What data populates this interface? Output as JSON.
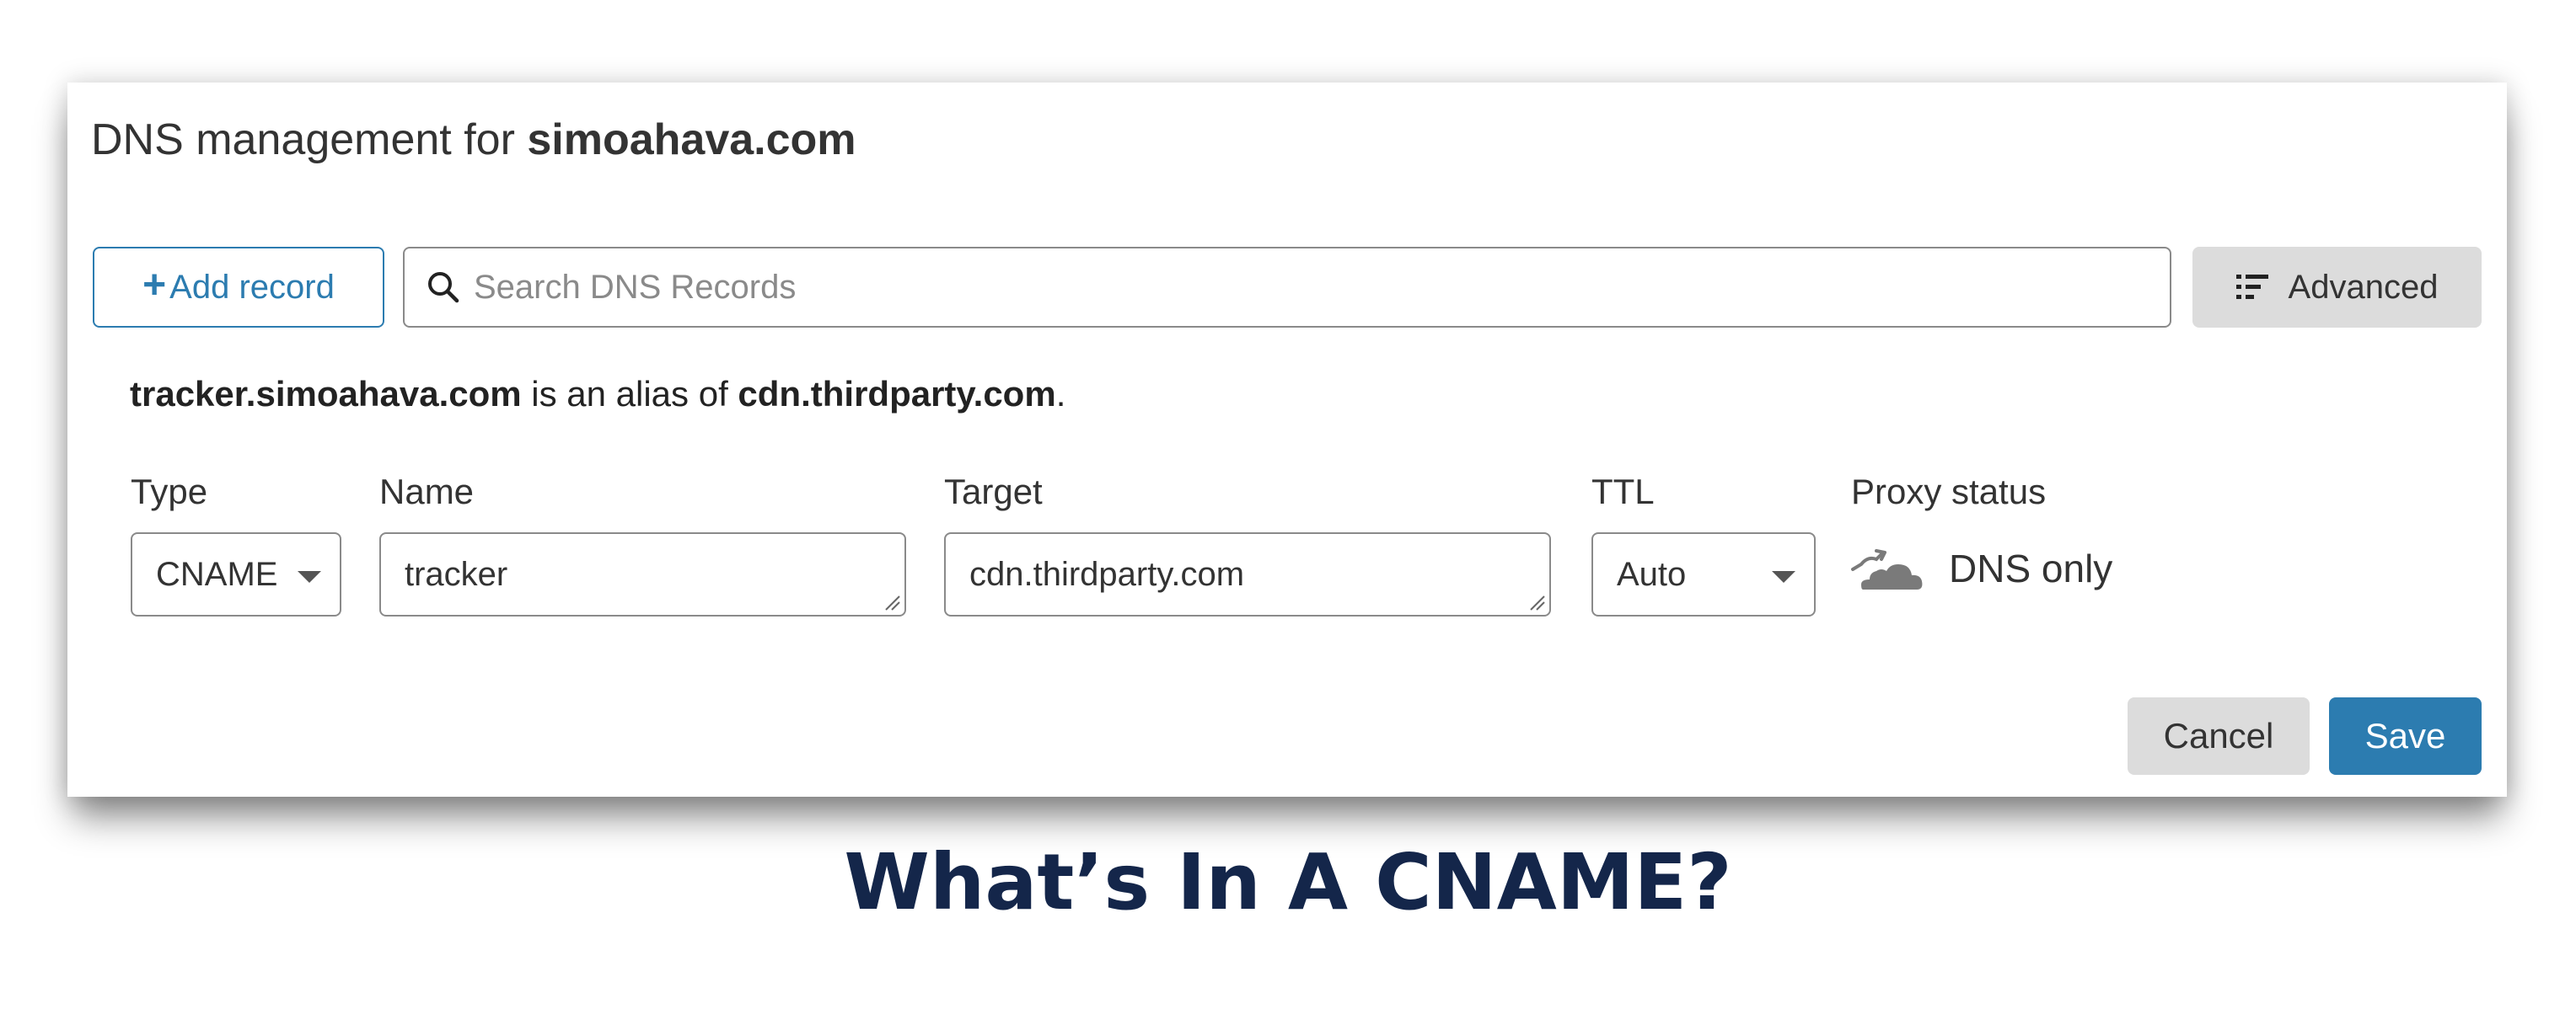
{
  "dialog": {
    "title_prefix": "DNS management for ",
    "title_domain": "simoahava.com"
  },
  "toolbar": {
    "add_record_icon": "+",
    "add_record_label": "Add record",
    "search_placeholder": "Search DNS Records",
    "search_icon": "search-icon",
    "advanced_icon": "list-filter-icon",
    "advanced_label": "Advanced"
  },
  "alias_notice": {
    "host": "tracker.simoahava.com",
    "middle": " is an alias of ",
    "target": "cdn.thirdparty.com",
    "end": "."
  },
  "form": {
    "type_label": "Type",
    "type_value": "CNAME",
    "name_label": "Name",
    "name_value": "tracker",
    "target_label": "Target",
    "target_value": "cdn.thirdparty.com",
    "ttl_label": "TTL",
    "ttl_value": "Auto",
    "proxy_label": "Proxy status",
    "proxy_icon": "cloud-bypass-icon",
    "proxy_value": "DNS only"
  },
  "actions": {
    "cancel_label": "Cancel",
    "save_label": "Save"
  },
  "caption": {
    "text": "What’s In A CNAME?"
  },
  "colors": {
    "accent": "#2c7cb0",
    "button_gray": "#dcdcdc",
    "caption": "#14264a"
  }
}
